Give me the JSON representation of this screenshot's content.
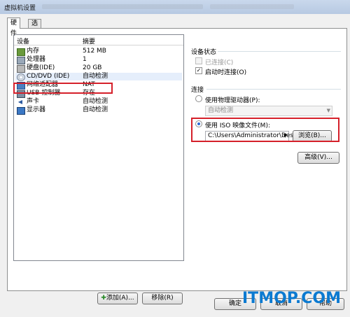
{
  "window": {
    "title": "虚拟机设置"
  },
  "tabs": [
    {
      "label": "硬件"
    },
    {
      "label": "选项"
    }
  ],
  "device_list": {
    "headers": {
      "device": "设备",
      "summary": "摘要"
    },
    "rows": [
      {
        "icon": "memory-icon",
        "name": "内存",
        "summary": "512 MB"
      },
      {
        "icon": "processor-icon",
        "name": "处理器",
        "summary": "1"
      },
      {
        "icon": "harddisk-icon",
        "name": "硬盘(IDE)",
        "summary": "20 GB"
      },
      {
        "icon": "cdrom-icon",
        "name": "CD/DVD (IDE)",
        "summary": "自动检测"
      },
      {
        "icon": "network-icon",
        "name": "网络适配器",
        "summary": "NAT"
      },
      {
        "icon": "usb-icon",
        "name": "USB 控制器",
        "summary": "存在"
      },
      {
        "icon": "sound-icon",
        "name": "声卡",
        "summary": "自动检测"
      },
      {
        "icon": "display-icon",
        "name": "显示器",
        "summary": "自动检测"
      }
    ],
    "add_label": "添加(A)...",
    "remove_label": "移除(R)"
  },
  "device_status": {
    "title": "设备状态",
    "connected": "已连接(C)",
    "connect_at_power_on": "启动时连接(O)"
  },
  "connection": {
    "title": "连接",
    "physical_label": "使用物理驱动器(P):",
    "physical_value": "自动检测",
    "iso_label": "使用 ISO 映像文件(M):",
    "iso_path": "C:\\Users\\Administrator\\Desk",
    "browse_label": "浏览(B)...",
    "advanced_label": "高级(V)..."
  },
  "footer": {
    "ok_label": "确定",
    "cancel_label": "取消",
    "help_label": "帮助"
  },
  "watermark": "ITMOP.COM"
}
